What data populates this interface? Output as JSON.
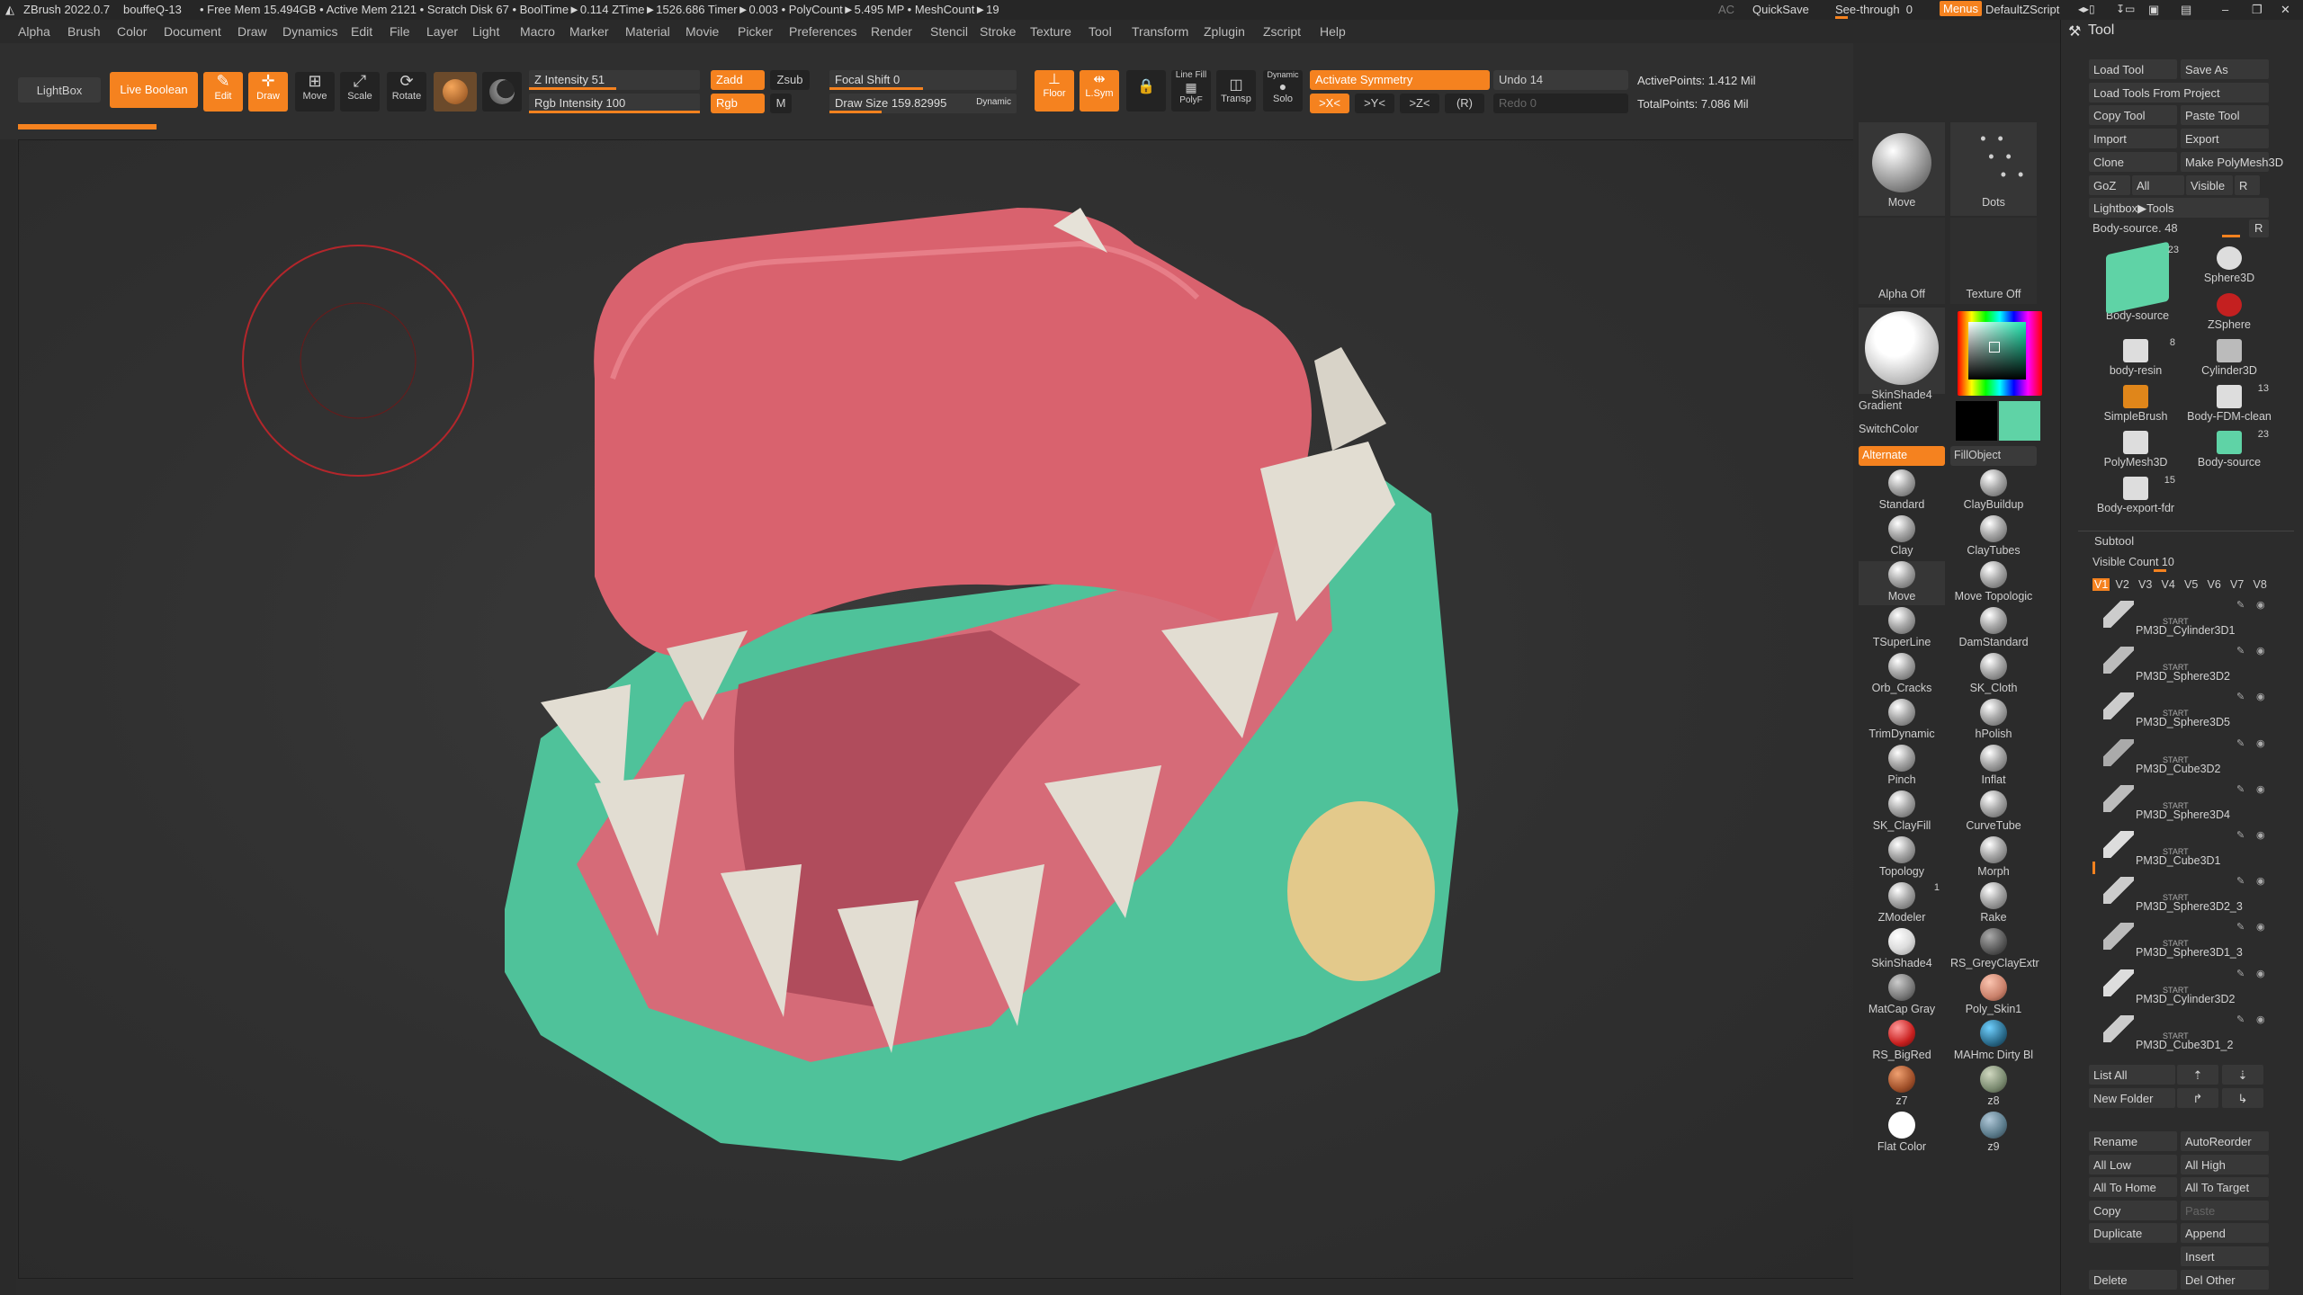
{
  "titlebar": {
    "app": "ZBrush 2022.0.7",
    "doc": "bouffeQ-13",
    "stats": "• Free Mem 15.494GB • Active Mem 2121 • Scratch Disk 67 • BoolTime►0.114 ZTime►1526.686 Timer►0.003 • PolyCount►5.495 MP • MeshCount►19",
    "ac": "AC",
    "quicksave": "QuickSave",
    "seethrough": "See-through",
    "seethrough_val": "0",
    "menus": "Menus",
    "script": "DefaultZScript"
  },
  "menubar": [
    "Alpha",
    "Brush",
    "Color",
    "Document",
    "Draw",
    "Dynamics",
    "Edit",
    "File",
    "Layer",
    "Light",
    "Macro",
    "Marker",
    "Material",
    "Movie",
    "Picker",
    "Preferences",
    "Render",
    "Stencil",
    "Stroke",
    "Texture",
    "Tool",
    "Transform",
    "Zplugin",
    "Zscript",
    "Help"
  ],
  "toolbar": {
    "lightbox": "LightBox",
    "live_boolean": "Live Boolean",
    "edit": "Edit",
    "draw": "Draw",
    "move": "Move",
    "scale": "Scale",
    "rotate": "Rotate",
    "z_intensity_label": "Z Intensity",
    "z_intensity_val": "51",
    "rgb_intensity_label": "Rgb Intensity",
    "rgb_intensity_val": "100",
    "zadd": "Zadd",
    "zsub": "Zsub",
    "rgb": "Rgb",
    "m": "M",
    "focal_shift_label": "Focal Shift",
    "focal_shift_val": "0",
    "draw_size_label": "Draw Size",
    "draw_size_val": "159.82995",
    "dynamic": "Dynamic",
    "floor": "Floor",
    "lsym": "L.Sym",
    "polyf": "PolyF",
    "linefill": "Line Fill",
    "transp": "Transp",
    "solo": "Solo",
    "dynamic2": "Dynamic",
    "activate_symmetry": "Activate Symmetry",
    "sym_x": ">X<",
    "sym_y": ">Y<",
    "sym_z": ">Z<",
    "sym_r": "(R)",
    "undo": "Undo 14",
    "redo": "Redo 0",
    "active_points": "ActivePoints: 1.412 Mil",
    "total_points": "TotalPoints: 7.086 Mil"
  },
  "palette": {
    "brush_move": "Move",
    "stroke_dots": "Dots",
    "alpha_off": "Alpha Off",
    "texture_off": "Texture Off",
    "material": "SkinShade4",
    "gradient": "Gradient",
    "switchcolor": "SwitchColor",
    "alternate": "Alternate",
    "fillobject": "FillObject",
    "brushes": [
      "Standard",
      "ClayBuildup",
      "Clay",
      "ClayTubes",
      "Move",
      "Move Topologic",
      "TSuperLine",
      "DamStandard",
      "Orb_Cracks",
      "SK_Cloth",
      "TrimDynamic",
      "hPolish",
      "Pinch",
      "Inflat",
      "SK_ClayFill",
      "CurveTube",
      "Topology",
      "Morph",
      "ZModeler",
      "Rake",
      "SkinShade4",
      "RS_GreyClayExtr",
      "MatCap Gray",
      "Poly_Skin1",
      "RS_BigRed",
      "MAHmc Dirty Bl",
      "z7",
      "z8",
      "Flat Color",
      "z9"
    ],
    "zmodeler_badge": "1",
    "colors": {
      "primary": "#f5821f",
      "main_swatch": "#000000",
      "secondary_swatch": "#5fd3a6"
    }
  },
  "toolpanel": {
    "title": "Tool",
    "buttons": [
      [
        "Load Tool",
        "Save As"
      ],
      [
        "Load Tools From Project"
      ],
      [
        "Copy Tool",
        "Paste Tool"
      ],
      [
        "Import",
        "Export"
      ],
      [
        "Clone",
        "Make PolyMesh3D"
      ],
      [
        "GoZ",
        "All",
        "Visible",
        "R"
      ],
      [
        "Lightbox▶Tools"
      ]
    ],
    "body_source_label": "Body-source. 48",
    "body_source_r": "R",
    "tools": [
      {
        "name": "Body-source",
        "badge": "23"
      },
      {
        "name": "Sphere3D",
        "badge": ""
      },
      {
        "name": "ZSphere",
        "badge": ""
      },
      {
        "name": "body-resin",
        "badge": "8"
      },
      {
        "name": "Cylinder3D",
        "badge": ""
      },
      {
        "name": "SimpleBrush",
        "badge": ""
      },
      {
        "name": "Body-FDM-clean",
        "badge": "13"
      },
      {
        "name": "PolyMesh3D",
        "badge": ""
      },
      {
        "name": "Body-source",
        "badge": "23"
      },
      {
        "name": "Body-export-fdr",
        "badge": "15"
      }
    ],
    "subtool_title": "Subtool",
    "visible_count": "Visible Count 10",
    "visibility_sets": [
      "V1",
      "V2",
      "V3",
      "V4",
      "V5",
      "V6",
      "V7",
      "V8"
    ],
    "subtools": [
      "PM3D_Cylinder3D1",
      "PM3D_Sphere3D2",
      "PM3D_Sphere3D5",
      "PM3D_Cube3D2",
      "PM3D_Sphere3D4",
      "PM3D_Cube3D1",
      "PM3D_Sphere3D2_3",
      "PM3D_Sphere3D1_3",
      "PM3D_Cylinder3D2",
      "PM3D_Cube3D1_2"
    ],
    "subtool_start": "START",
    "list_all": "List All",
    "new_folder": "New Folder",
    "actions": [
      [
        "Rename",
        "AutoReorder"
      ],
      [
        "All Low",
        "All High"
      ],
      [
        "All To Home",
        "All To Target"
      ],
      [
        "Copy",
        "Paste"
      ],
      [
        "Duplicate",
        "Append"
      ],
      [
        "",
        "Insert"
      ],
      [
        "Delete",
        "Del Other"
      ]
    ]
  }
}
